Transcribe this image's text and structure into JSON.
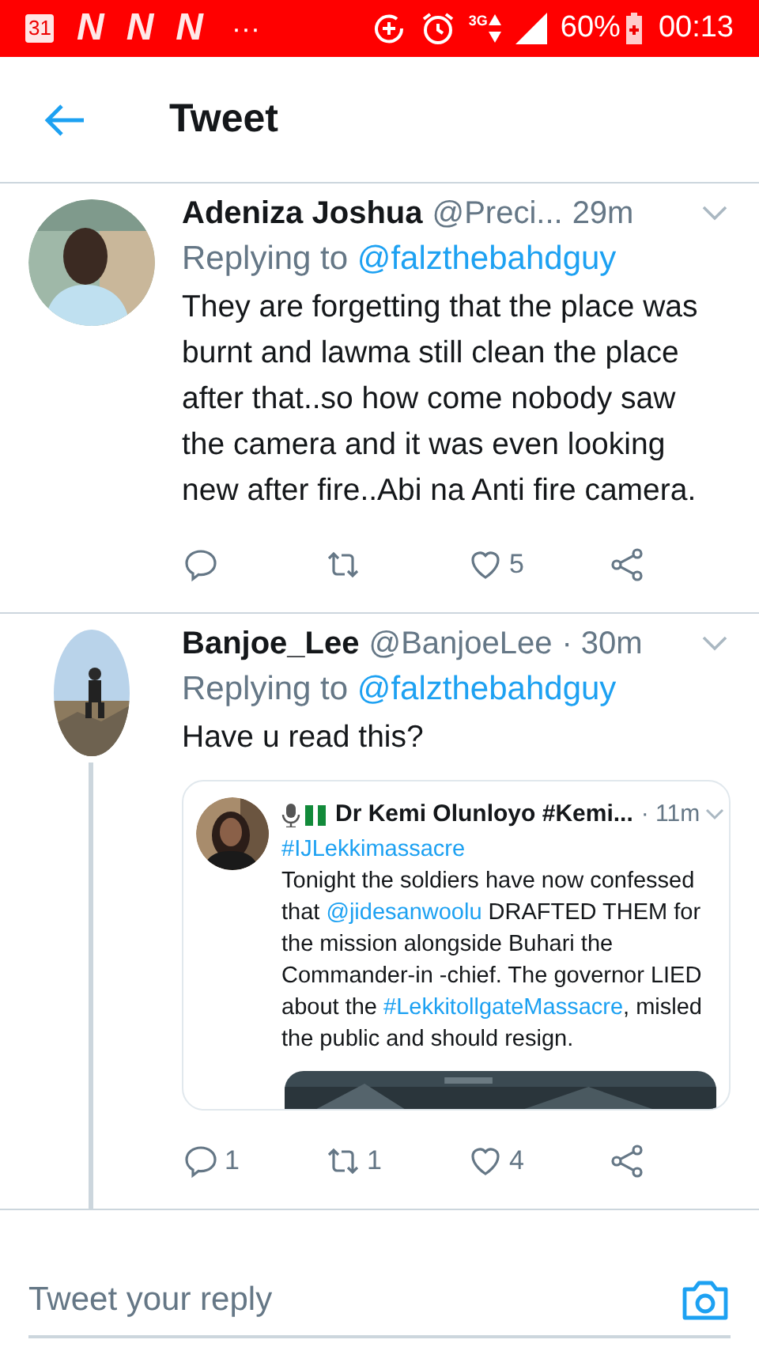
{
  "status_bar": {
    "calendar_day": "31",
    "notification_icons": [
      "N",
      "N",
      "N"
    ],
    "overflow": "···",
    "network": "3G",
    "battery": "60%",
    "time": "00:13"
  },
  "header": {
    "title": "Tweet"
  },
  "tweets": [
    {
      "author": "Adeniza Joshua",
      "handle": "@Preci...",
      "time": "29m",
      "replying_label": "Replying to",
      "replying_to": "@falzthebahdguy",
      "text": "They are forgetting that the place was burnt and lawma still clean the place after that..so how come nobody saw the camera and it was even looking new after fire..Abi na Anti fire camera.",
      "thread_continues": false,
      "actions": [
        {
          "kind": "reply"
        },
        {
          "kind": "retweet"
        },
        {
          "kind": "like",
          "count": "5"
        },
        {
          "kind": "share"
        }
      ]
    },
    {
      "author": "Banjoe_Lee",
      "handle": "@BanjoeLee",
      "time": "· 30m",
      "replying_label": "Replying to",
      "replying_to": "@falzthebahdguy",
      "text": "Have u read this?",
      "thread_continues": true,
      "quote": {
        "author": "Dr Kemi Olunloyo #Kemi...",
        "time": "· 11m",
        "segments": [
          {
            "kind": "link",
            "text": "#IJLekkimassacre"
          },
          {
            "kind": "break"
          },
          {
            "kind": "plain",
            "text": "Tonight the soldiers have now confessed that "
          },
          {
            "kind": "link",
            "text": "@jidesanwoolu"
          },
          {
            "kind": "plain",
            "text": " DRAFTED THEM for the mission alongside Buhari the Commander-in -chief. The governor LIED about the "
          },
          {
            "kind": "link",
            "text": "#LekkitollgateMassacre"
          },
          {
            "kind": "plain",
            "text": ", misled the public and should resign."
          }
        ]
      },
      "actions": [
        {
          "kind": "reply",
          "count": "1"
        },
        {
          "kind": "retweet",
          "count": "1"
        },
        {
          "kind": "like",
          "count": "4"
        },
        {
          "kind": "share"
        }
      ]
    }
  ],
  "reply_box": {
    "placeholder": "Tweet your reply"
  }
}
